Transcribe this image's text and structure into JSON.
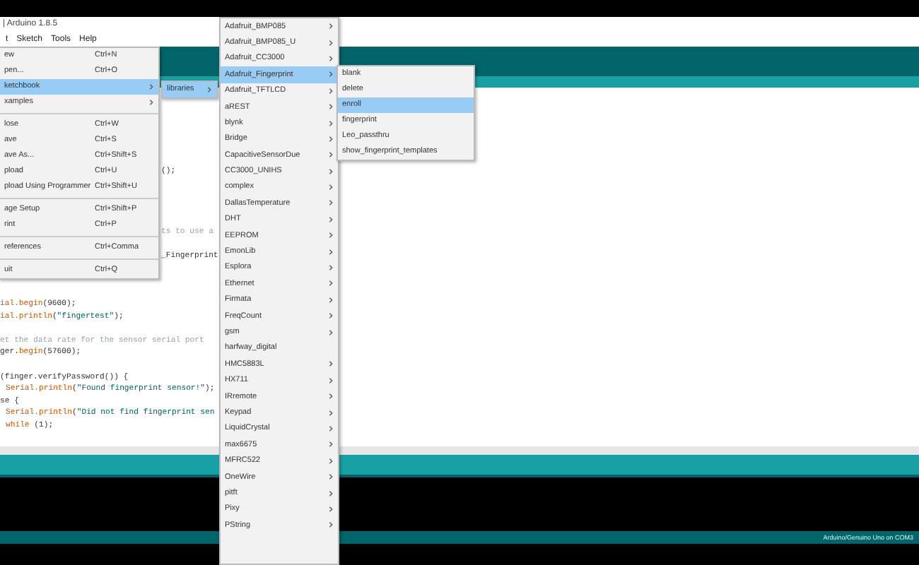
{
  "window": {
    "title": "| Arduino 1.8.5"
  },
  "menu_bar": [
    {
      "label": "t",
      "selected": false
    },
    {
      "label": "Sketch",
      "selected": false
    },
    {
      "label": "Tools",
      "selected": false
    },
    {
      "label": "Help",
      "selected": false
    }
  ],
  "file_menu": [
    {
      "kind": "item",
      "label": "ew",
      "shortcut": "Ctrl+N",
      "has_submenu": false,
      "selected": false
    },
    {
      "kind": "item",
      "label": "pen...",
      "shortcut": "Ctrl+O",
      "has_submenu": false,
      "selected": false
    },
    {
      "kind": "item",
      "label": "ketchbook",
      "has_submenu": true,
      "selected": true
    },
    {
      "kind": "item",
      "label": "xamples",
      "has_submenu": true,
      "selected": false
    },
    {
      "kind": "separator"
    },
    {
      "kind": "item",
      "label": "lose",
      "shortcut": "Ctrl+W",
      "has_submenu": false,
      "selected": false
    },
    {
      "kind": "item",
      "label": "ave",
      "shortcut": "Ctrl+S",
      "has_submenu": false,
      "selected": false
    },
    {
      "kind": "item",
      "label": "ave As...",
      "shortcut": "Ctrl+Shift+S",
      "has_submenu": false,
      "selected": false
    },
    {
      "kind": "item",
      "label": "pload",
      "shortcut": "Ctrl+U",
      "has_submenu": false,
      "selected": false
    },
    {
      "kind": "item",
      "label": "pload Using Programmer",
      "shortcut": "Ctrl+Shift+U",
      "has_submenu": false,
      "selected": false
    },
    {
      "kind": "separator"
    },
    {
      "kind": "item",
      "label": "age Setup",
      "shortcut": "Ctrl+Shift+P",
      "has_submenu": false,
      "selected": false
    },
    {
      "kind": "item",
      "label": "rint",
      "shortcut": "Ctrl+P",
      "has_submenu": false,
      "selected": false
    },
    {
      "kind": "separator"
    },
    {
      "kind": "item",
      "label": "references",
      "shortcut": "Ctrl+Comma",
      "has_submenu": false,
      "selected": false
    },
    {
      "kind": "separator"
    },
    {
      "kind": "item",
      "label": "uit",
      "shortcut": "Ctrl+Q",
      "has_submenu": false,
      "selected": false
    }
  ],
  "sketchbook_menu": [
    {
      "label": "libraries",
      "has_submenu": true,
      "selected": true
    }
  ],
  "libraries_menu": [
    {
      "label": "Adafruit_BMP085",
      "has_submenu": true,
      "selected": false
    },
    {
      "label": "Adafruit_BMP085_U",
      "has_submenu": true,
      "selected": false
    },
    {
      "label": "Adafruit_CC3000",
      "has_submenu": true,
      "selected": false
    },
    {
      "label": "Adafruit_Fingerprint",
      "has_submenu": true,
      "selected": true
    },
    {
      "label": "Adafruit_TFTLCD",
      "has_submenu": true,
      "selected": false
    },
    {
      "label": "aREST",
      "has_submenu": true,
      "selected": false
    },
    {
      "label": "blynk",
      "has_submenu": true,
      "selected": false
    },
    {
      "label": "Bridge",
      "has_submenu": true,
      "selected": false
    },
    {
      "label": "CapacitiveSensorDue",
      "has_submenu": true,
      "selected": false
    },
    {
      "label": "CC3000_UNIHS",
      "has_submenu": true,
      "selected": false
    },
    {
      "label": "complex",
      "has_submenu": true,
      "selected": false
    },
    {
      "label": "DallasTemperature",
      "has_submenu": true,
      "selected": false
    },
    {
      "label": "DHT",
      "has_submenu": true,
      "selected": false
    },
    {
      "label": "EEPROM",
      "has_submenu": true,
      "selected": false
    },
    {
      "label": "EmonLib",
      "has_submenu": true,
      "selected": false
    },
    {
      "label": "Esplora",
      "has_submenu": true,
      "selected": false
    },
    {
      "label": "Ethernet",
      "has_submenu": true,
      "selected": false
    },
    {
      "label": "Firmata",
      "has_submenu": true,
      "selected": false
    },
    {
      "label": "FreqCount",
      "has_submenu": true,
      "selected": false
    },
    {
      "label": "gsm",
      "has_submenu": true,
      "selected": false
    },
    {
      "label": "harfway_digital",
      "has_submenu": false,
      "selected": false
    },
    {
      "label": "HMC5883L",
      "has_submenu": true,
      "selected": false
    },
    {
      "label": "HX711",
      "has_submenu": true,
      "selected": false
    },
    {
      "label": "IRremote",
      "has_submenu": true,
      "selected": false
    },
    {
      "label": "Keypad",
      "has_submenu": true,
      "selected": false
    },
    {
      "label": "LiquidCrystal",
      "has_submenu": true,
      "selected": false
    },
    {
      "label": "max6675",
      "has_submenu": true,
      "selected": false
    },
    {
      "label": "MFRC522",
      "has_submenu": true,
      "selected": false
    },
    {
      "label": "OneWire",
      "has_submenu": true,
      "selected": false
    },
    {
      "label": "pitft",
      "has_submenu": true,
      "selected": false
    },
    {
      "label": "Pixy",
      "has_submenu": true,
      "selected": false
    },
    {
      "label": "PString",
      "has_submenu": true,
      "selected": false
    }
  ],
  "fingerprint_menu": [
    {
      "label": "blank",
      "selected": false
    },
    {
      "label": "delete",
      "selected": false
    },
    {
      "label": "enroll",
      "selected": true
    },
    {
      "label": "fingerprint",
      "selected": false
    },
    {
      "label": "Leo_passthru",
      "selected": false
    },
    {
      "label": "show_fingerprint_templates",
      "selected": false
    }
  ],
  "editor": {
    "lines": [
      {
        "kind": "blank"
      },
      {
        "kind": "blank"
      },
      {
        "kind": "blank"
      },
      {
        "kind": "blank"
      },
      {
        "kind": "blank"
      },
      {
        "kind": "blank"
      },
      {
        "kind": "partial",
        "segments": [
          {
            "kind": "plain",
            "text": "();"
          }
        ]
      },
      {
        "kind": "blank"
      },
      {
        "kind": "blank"
      },
      {
        "kind": "blank"
      },
      {
        "kind": "blank"
      },
      {
        "kind": "partial",
        "segments": [
          {
            "kind": "comment",
            "text": "ts to use a"
          }
        ]
      },
      {
        "kind": "blank"
      },
      {
        "kind": "partial",
        "segments": [
          {
            "kind": "plain",
            "text": "_Fingerprint"
          }
        ]
      },
      {
        "kind": "blank"
      },
      {
        "kind": "blank"
      },
      {
        "kind": "blank"
      },
      {
        "kind": "plain",
        "segments": [
          {
            "kind": "keyword",
            "text": "ial.begin"
          },
          {
            "kind": "plain",
            "text": "(9600);"
          }
        ]
      },
      {
        "kind": "plain",
        "segments": [
          {
            "kind": "keyword",
            "text": "ial.println"
          },
          {
            "kind": "plain",
            "text": "("
          },
          {
            "kind": "string",
            "text": "\"fingertest\""
          },
          {
            "kind": "plain",
            "text": ");"
          }
        ]
      },
      {
        "kind": "blank"
      },
      {
        "kind": "plain",
        "segments": [
          {
            "kind": "comment",
            "text": "et the data rate for the sensor serial port"
          }
        ]
      },
      {
        "kind": "plain",
        "segments": [
          {
            "kind": "plain",
            "text": "ger."
          },
          {
            "kind": "keyword",
            "text": "begin"
          },
          {
            "kind": "plain",
            "text": "(57600);"
          }
        ]
      },
      {
        "kind": "blank"
      },
      {
        "kind": "plain",
        "segments": [
          {
            "kind": "plain",
            "text": "(finger.verifyPassword()) {"
          }
        ]
      },
      {
        "kind": "indented",
        "segments": [
          {
            "kind": "keyword",
            "text": "Serial.println"
          },
          {
            "kind": "plain",
            "text": "("
          },
          {
            "kind": "string",
            "text": "\"Found fingerprint sensor!\""
          },
          {
            "kind": "plain",
            "text": ");"
          }
        ]
      },
      {
        "kind": "plain",
        "segments": [
          {
            "kind": "plain",
            "text": "se {"
          }
        ]
      },
      {
        "kind": "indented",
        "segments": [
          {
            "kind": "keyword",
            "text": "Serial.println"
          },
          {
            "kind": "plain",
            "text": "("
          },
          {
            "kind": "string",
            "text": "\"Did not find fingerprint sen"
          }
        ]
      },
      {
        "kind": "indented",
        "segments": [
          {
            "kind": "keyword",
            "text": "while"
          },
          {
            "kind": "plain",
            "text": " (1);"
          }
        ]
      }
    ]
  },
  "status_bar": {
    "board": "Arduino/Genuino Uno on COM3"
  }
}
